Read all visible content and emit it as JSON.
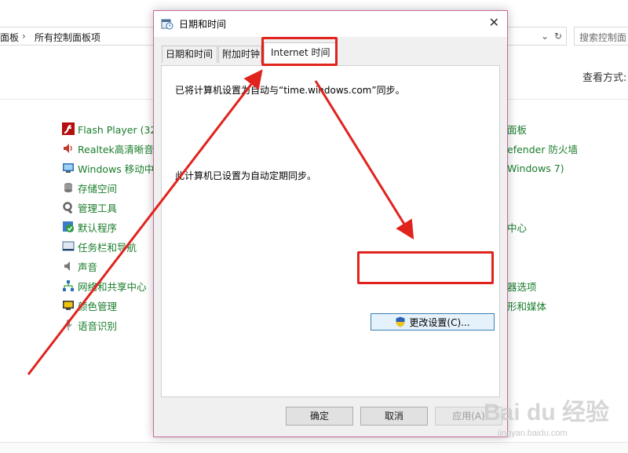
{
  "control_panel": {
    "breadcrumb": [
      "面板",
      "所有控制面板项"
    ],
    "breadcrumb_separator": "›",
    "search_placeholder": "搜索控制面",
    "view_by_label": "查看方式:",
    "left_items": [
      {
        "label": "Flash Player (32 位",
        "icon": "flash-icon"
      },
      {
        "label": "Realtek高清晰音频",
        "icon": "speaker-icon"
      },
      {
        "label": "Windows 移动中心",
        "icon": "mobility-center-icon"
      },
      {
        "label": "存储空间",
        "icon": "storage-icon"
      },
      {
        "label": "管理工具",
        "icon": "admin-tools-icon"
      },
      {
        "label": "默认程序",
        "icon": "default-programs-icon"
      },
      {
        "label": "任务栏和导航",
        "icon": "taskbar-icon"
      },
      {
        "label": "声音",
        "icon": "sound-icon"
      },
      {
        "label": "网络和共享中心",
        "icon": "network-icon"
      },
      {
        "label": "颜色管理",
        "icon": "color-management-icon"
      },
      {
        "label": "语音识别",
        "icon": "microphone-icon"
      }
    ],
    "right_items": [
      "面板",
      "efender 防火墙",
      "Windows 7)",
      "中心",
      "器选项",
      "形和媒体"
    ]
  },
  "dialog": {
    "title": "日期和时间",
    "close_glyph": "✕",
    "tabs": [
      {
        "label": "日期和时间",
        "active": false
      },
      {
        "label": "附加时钟",
        "active": false
      },
      {
        "label": "Internet 时间",
        "active": true
      }
    ],
    "sync_message": "已将计算机设置为自动与“time.windows.com”同步。",
    "schedule_message": "此计算机已设置为自动定期同步。",
    "change_settings_button": "更改设置(C)...",
    "ok_button": "确定",
    "cancel_button": "取消",
    "apply_button": "应用(A)"
  },
  "annotations": {
    "highlight_color": "#e0231d"
  },
  "watermark": {
    "brand": "Bai du 经验",
    "url": "jingyan.baidu.com"
  },
  "colors": {
    "link_green": "#1a7d2c",
    "dialog_border": "#c56a9e",
    "primary_button_border": "#3c7fb1"
  }
}
